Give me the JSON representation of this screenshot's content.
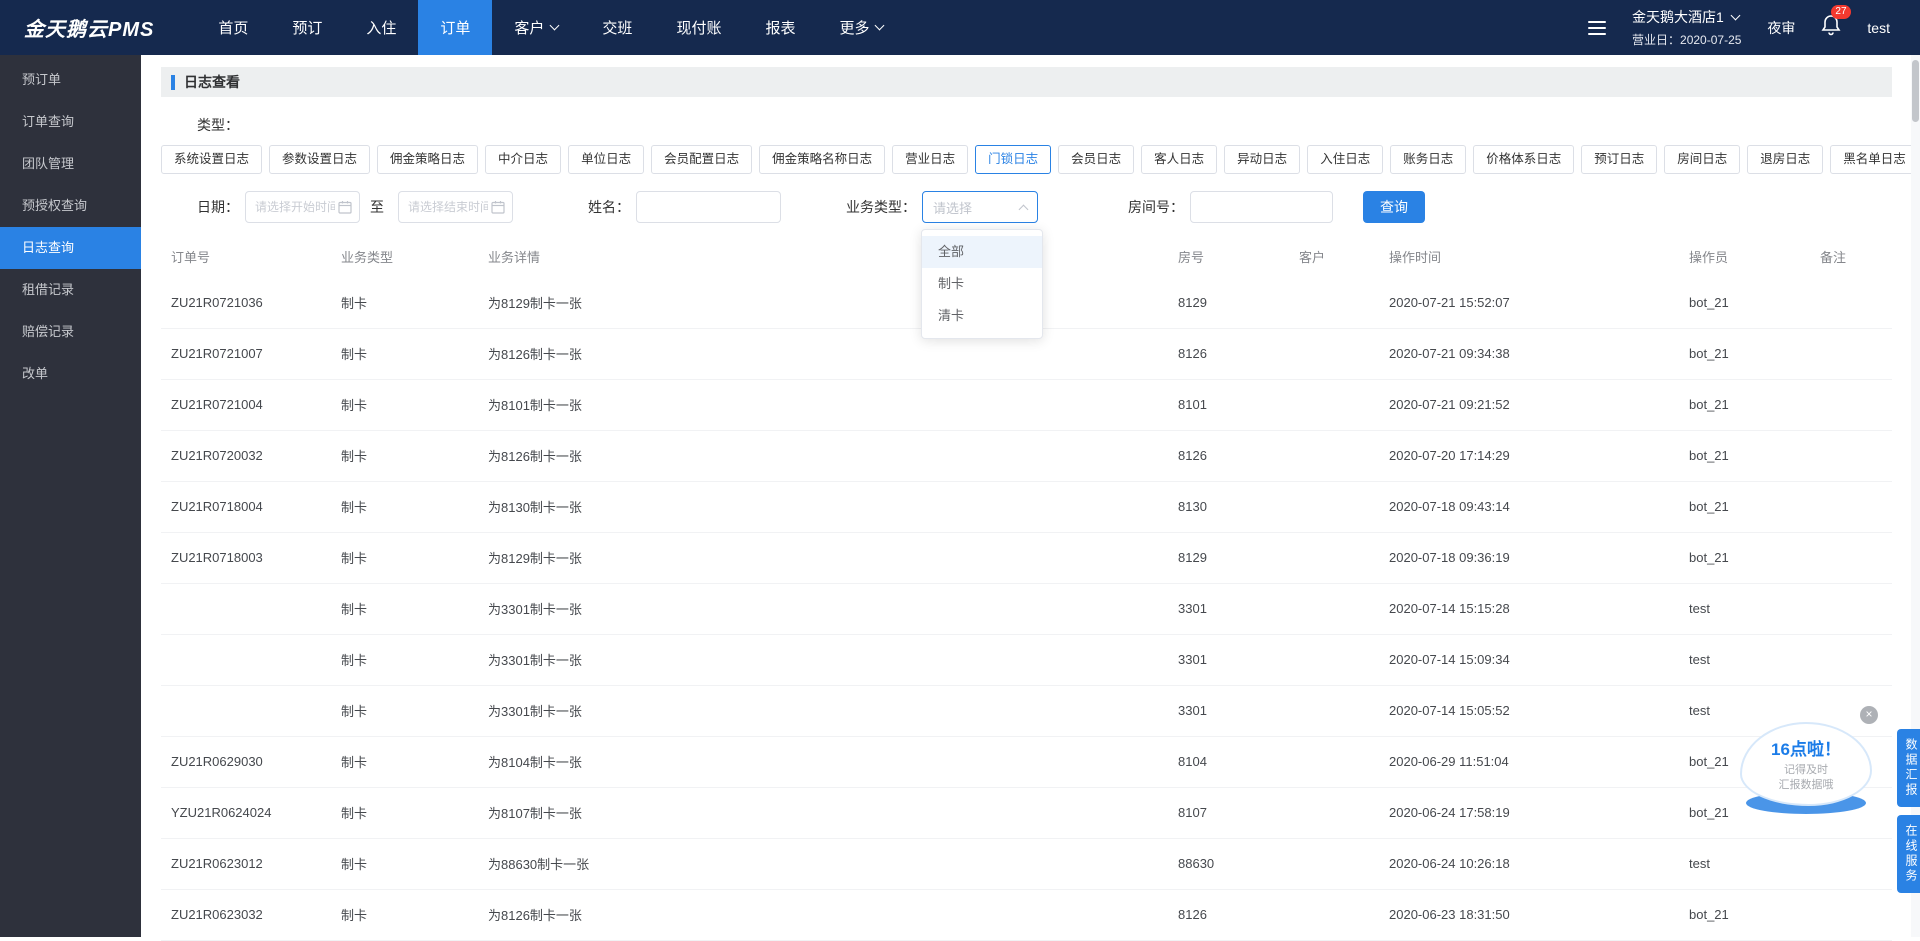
{
  "topbar": {
    "logo": "金天鹅云PMS",
    "nav": [
      {
        "label": "首页"
      },
      {
        "label": "预订"
      },
      {
        "label": "入住"
      },
      {
        "label": "订单",
        "active": true
      },
      {
        "label": "客户",
        "dropdown": true
      },
      {
        "label": "交班"
      },
      {
        "label": "现付账"
      },
      {
        "label": "报表"
      },
      {
        "label": "更多",
        "dropdown": true
      }
    ],
    "hotel_name": "金天鹅大酒店1",
    "business_day": "营业日：2020-07-25",
    "night_audit_label": "夜审",
    "notification_count": "27",
    "username": "test"
  },
  "sidebar": {
    "items": [
      {
        "label": "预订单"
      },
      {
        "label": "订单查询"
      },
      {
        "label": "团队管理"
      },
      {
        "label": "预授权查询"
      },
      {
        "label": "日志查询",
        "active": true
      },
      {
        "label": "租借记录"
      },
      {
        "label": "赔偿记录"
      },
      {
        "label": "改单"
      }
    ]
  },
  "page": {
    "title": "日志查看",
    "type_label": "类型：",
    "log_type_tabs": [
      {
        "label": "系统设置日志"
      },
      {
        "label": "参数设置日志"
      },
      {
        "label": "佣金策略日志"
      },
      {
        "label": "中介日志"
      },
      {
        "label": "单位日志"
      },
      {
        "label": "会员配置日志"
      },
      {
        "label": "佣金策略名称日志"
      },
      {
        "label": "营业日志"
      },
      {
        "label": "门锁日志",
        "active": true
      },
      {
        "label": "会员日志"
      },
      {
        "label": "客人日志"
      },
      {
        "label": "异动日志"
      },
      {
        "label": "入住日志"
      },
      {
        "label": "账务日志"
      },
      {
        "label": "价格体系日志"
      },
      {
        "label": "预订日志"
      },
      {
        "label": "房间日志"
      },
      {
        "label": "退房日志"
      },
      {
        "label": "黑名单日志"
      }
    ],
    "filters": {
      "date_label": "日期：",
      "date_start_placeholder": "请选择开始时间",
      "range_separator": "至",
      "date_end_placeholder": "请选择结束时间",
      "name_label": "姓名：",
      "name_value": "",
      "business_type_label": "业务类型：",
      "business_type_placeholder": "请选择",
      "room_label": "房间号：",
      "room_value": "",
      "search_button": "查询"
    },
    "business_type_options": [
      {
        "label": "全部",
        "highlighted": true
      },
      {
        "label": "制卡"
      },
      {
        "label": "清卡"
      }
    ],
    "table": {
      "headers": [
        "订单号",
        "业务类型",
        "业务详情",
        "房号",
        "客户",
        "操作时间",
        "操作员",
        "备注"
      ],
      "rows": [
        [
          "ZU21R0721036",
          "制卡",
          "为8129制卡一张",
          "8129",
          "",
          "2020-07-21 15:52:07",
          "bot_21",
          ""
        ],
        [
          "ZU21R0721007",
          "制卡",
          "为8126制卡一张",
          "8126",
          "",
          "2020-07-21 09:34:38",
          "bot_21",
          ""
        ],
        [
          "ZU21R0721004",
          "制卡",
          "为8101制卡一张",
          "8101",
          "",
          "2020-07-21 09:21:52",
          "bot_21",
          ""
        ],
        [
          "ZU21R0720032",
          "制卡",
          "为8126制卡一张",
          "8126",
          "",
          "2020-07-20 17:14:29",
          "bot_21",
          ""
        ],
        [
          "ZU21R0718004",
          "制卡",
          "为8130制卡一张",
          "8130",
          "",
          "2020-07-18 09:43:14",
          "bot_21",
          ""
        ],
        [
          "ZU21R0718003",
          "制卡",
          "为8129制卡一张",
          "8129",
          "",
          "2020-07-18 09:36:19",
          "bot_21",
          ""
        ],
        [
          "",
          "制卡",
          "为3301制卡一张",
          "3301",
          "",
          "2020-07-14 15:15:28",
          "test",
          ""
        ],
        [
          "",
          "制卡",
          "为3301制卡一张",
          "3301",
          "",
          "2020-07-14 15:09:34",
          "test",
          ""
        ],
        [
          "",
          "制卡",
          "为3301制卡一张",
          "3301",
          "",
          "2020-07-14 15:05:52",
          "test",
          ""
        ],
        [
          "ZU21R0629030",
          "制卡",
          "为8104制卡一张",
          "8104",
          "",
          "2020-06-29 11:51:04",
          "bot_21",
          ""
        ],
        [
          "YZU21R0624024",
          "制卡",
          "为8107制卡一张",
          "8107",
          "",
          "2020-06-24 17:58:19",
          "bot_21",
          ""
        ],
        [
          "ZU21R0623012",
          "制卡",
          "为88630制卡一张",
          "88630",
          "",
          "2020-06-24 10:26:18",
          "test",
          ""
        ],
        [
          "ZU21R0623032",
          "制卡",
          "为8126制卡一张",
          "8126",
          "",
          "2020-06-23 18:31:50",
          "bot_21",
          ""
        ]
      ]
    }
  },
  "reminder_widget": {
    "title": "16点啦！",
    "line1": "记得及时",
    "line2": "汇报数据哦",
    "close_icon": "×"
  },
  "side_tabs": [
    {
      "label": "数据汇报"
    },
    {
      "label": "在线服务"
    }
  ],
  "colors": {
    "topbar_bg": "#15294e",
    "accent_blue": "#2a82e4",
    "sidebar_bg": "#2e313c",
    "badge_red": "#f5392f"
  }
}
